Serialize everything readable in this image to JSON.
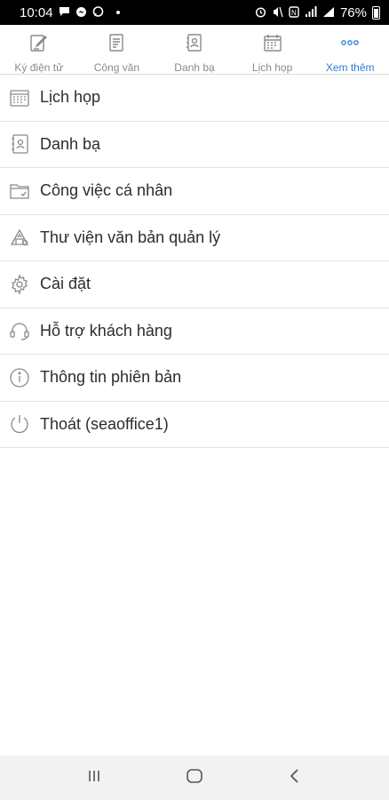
{
  "status_bar": {
    "time": "10:04",
    "battery": "76%",
    "left_icons": [
      "message-icon",
      "messenger-icon",
      "chat-icon"
    ],
    "right_icons": [
      "alarm-icon",
      "mute-icon",
      "nfc-icon",
      "wifi-icon",
      "signal-icon"
    ]
  },
  "tabs": [
    {
      "label": "Ký điện tử",
      "icon": "pen-sign-icon",
      "active": false
    },
    {
      "label": "Công văn",
      "icon": "document-icon",
      "active": false
    },
    {
      "label": "Danh bạ",
      "icon": "contacts-icon",
      "active": false
    },
    {
      "label": "Lịch họp",
      "icon": "calendar-icon",
      "active": false
    },
    {
      "label": "Xem thêm",
      "icon": "more-dots-icon",
      "active": true
    }
  ],
  "menu": [
    {
      "label": "Lịch họp",
      "icon": "calendar-icon"
    },
    {
      "label": "Danh bạ",
      "icon": "contacts-icon"
    },
    {
      "label": "Công việc cá nhân",
      "icon": "folder-icon"
    },
    {
      "label": "Thư viện văn bản quản lý",
      "icon": "library-icon"
    },
    {
      "label": "Cài đặt",
      "icon": "gear-icon"
    },
    {
      "label": "Hỗ trợ khách hàng",
      "icon": "headset-icon"
    },
    {
      "label": "Thông tin phiên bản",
      "icon": "info-icon"
    },
    {
      "label": "Thoát (seaoffice1)",
      "icon": "power-icon"
    }
  ],
  "colors": {
    "accent": "#2b7fd4",
    "icon_gray": "#8a8a8a",
    "text": "#2c2c2c",
    "divider": "#e3e3e3"
  }
}
